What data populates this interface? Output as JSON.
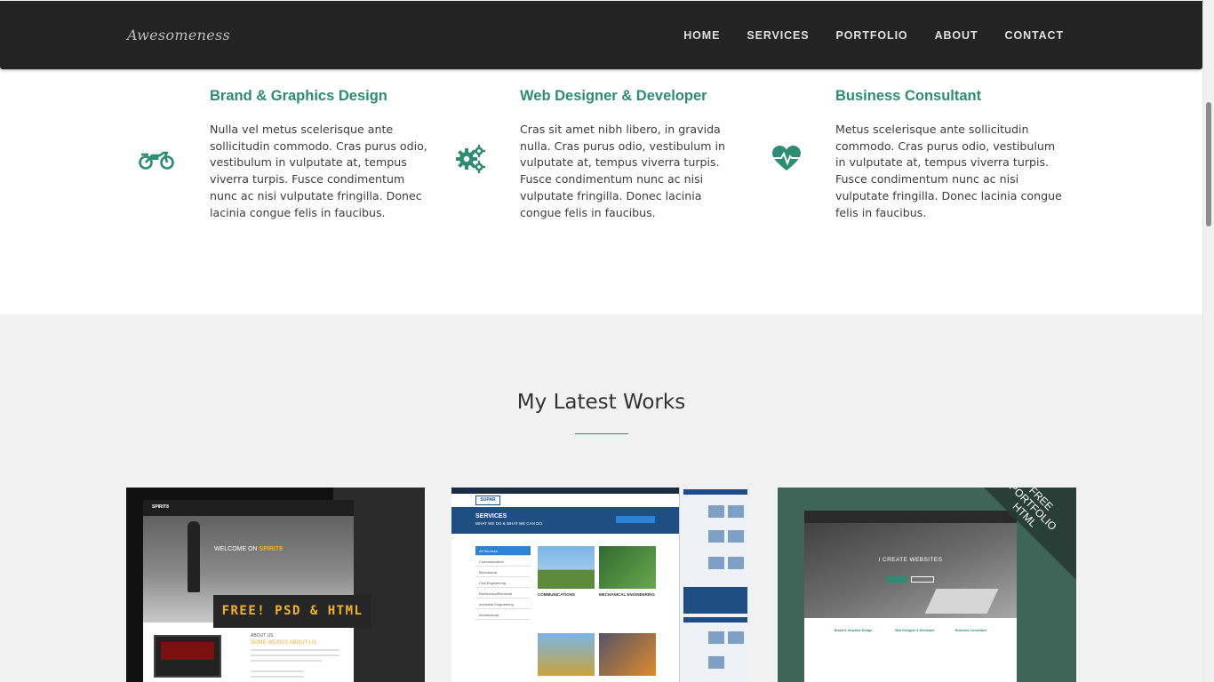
{
  "navbar": {
    "brand": "Awesomeness",
    "links": [
      "HOME",
      "SERVICES",
      "PORTFOLIO",
      "ABOUT",
      "CONTACT"
    ]
  },
  "services": [
    {
      "icon": "motorcycle-icon",
      "title": "Brand & Graphics Design",
      "text": "Nulla vel metus scelerisque ante sollicitudin commodo. Cras purus odio, vestibulum in vulputate at, tempus viverra turpis. Fusce condimentum nunc ac nisi vulputate fringilla. Donec lacinia congue felis in faucibus."
    },
    {
      "icon": "gears-icon",
      "title": "Web Designer & Developer",
      "text": "Cras sit amet nibh libero, in gravida nulla. Cras purus odio, vestibulum in vulputate at, tempus viverra turpis. Fusce condimentum nunc ac nisi vulputate fringilla. Donec lacinia congue felis in faucibus."
    },
    {
      "icon": "heartbeat-icon",
      "title": "Business Consultant",
      "text": "Metus scelerisque ante sollicitudin commodo. Cras purus odio, vestibulum in vulputate at, tempus viverra turpis. Fusce condimentum nunc ac nisi vulputate fringilla. Donec lacinia congue felis in faucibus."
    }
  ],
  "works": {
    "title": "My Latest Works",
    "items": [
      {
        "logo": "SPIRIT8",
        "welcome_prefix": "WELCOME ON ",
        "welcome_brand": "SPIRIT8",
        "banner": "FREE!  PSD & HTML",
        "about_label": "ABOUT US",
        "about_heading": "SOME WORDS ABOUT US"
      },
      {
        "logo": "SUPAR",
        "heading": "SERVICES",
        "subheading": "WHAT WE DO & WHAT WE CAN DO.",
        "menu": [
          "All Services",
          "Communication",
          "Mechanical",
          "Civil Engineering",
          "Electronics/Electrical",
          "Industrial Engineering",
          "Architectural"
        ],
        "cards": [
          "COMMUNICATIONS",
          "MECHANICAL ENGINEERING"
        ]
      },
      {
        "headline": "I CREATE WEBSITES",
        "ribbon": [
          "FREE",
          "PORTFOLIO",
          "HTML"
        ],
        "columns": [
          "Brand & Graphics Design",
          "Web Designer & Developer",
          "Business Consultant"
        ]
      }
    ]
  },
  "colors": {
    "accent": "#2e8b74",
    "navbar_bg": "#232323",
    "works_bg": "#f2f2f2"
  }
}
